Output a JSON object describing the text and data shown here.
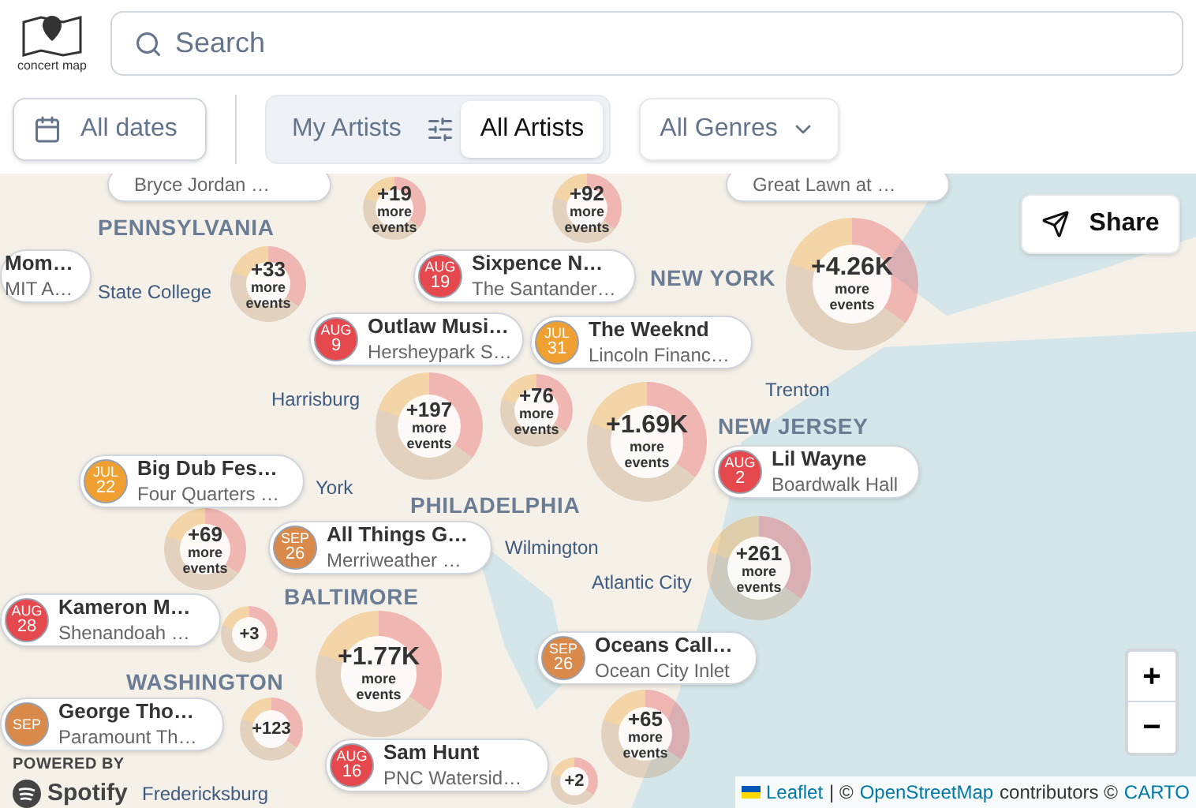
{
  "header": {
    "logo_text": "concert map",
    "search": {
      "placeholder": "Search"
    }
  },
  "filters": {
    "date_button": "All dates",
    "artist_toggle": [
      {
        "label": "My Artists",
        "selected": false
      },
      {
        "label": "All Artists",
        "selected": true
      }
    ],
    "genre_select": "All Genres"
  },
  "map": {
    "share_button": "Share",
    "place_labels": [
      {
        "text": "PENNSYLVANIA",
        "kind": "state"
      },
      {
        "text": "State College",
        "kind": "city"
      },
      {
        "text": "Harrisburg",
        "kind": "city"
      },
      {
        "text": "York",
        "kind": "city"
      },
      {
        "text": "PHILADELPHIA",
        "kind": "state"
      },
      {
        "text": "Wilmington",
        "kind": "city"
      },
      {
        "text": "NEW YORK",
        "kind": "state"
      },
      {
        "text": "NEW JERSEY",
        "kind": "state"
      },
      {
        "text": "Trenton",
        "kind": "city"
      },
      {
        "text": "Atlantic City",
        "kind": "city"
      },
      {
        "text": "BALTIMORE",
        "kind": "state"
      },
      {
        "text": "WASHINGTON",
        "kind": "state"
      },
      {
        "text": "Fredericksburg",
        "kind": "city"
      }
    ],
    "clusters": [
      {
        "count": "+19",
        "label": "more events"
      },
      {
        "count": "+92",
        "label": "more events"
      },
      {
        "count": "+33",
        "label": "more events"
      },
      {
        "count": "+76",
        "label": "more events"
      },
      {
        "count": "+197",
        "label": "more events"
      },
      {
        "count": "+1.69K",
        "label": "more events"
      },
      {
        "count": "+4.26K",
        "label": "more events"
      },
      {
        "count": "+69",
        "label": "more events"
      },
      {
        "count": "+1.77K",
        "label": "more events"
      },
      {
        "count": "+261",
        "label": "more events"
      },
      {
        "count": "+65",
        "label": "more events"
      },
      {
        "count": "+3"
      },
      {
        "count": "+2"
      },
      {
        "count": "+123"
      }
    ],
    "events": [
      {
        "venue": "Bryce Jordan …"
      },
      {
        "venue": "Great Lawn at …"
      },
      {
        "title": "Mom…",
        "venue": "MIT A…"
      },
      {
        "month": "AUG",
        "day": "19",
        "color": "#e5484d",
        "title": "Sixpence N…",
        "venue": "The Santander…"
      },
      {
        "month": "AUG",
        "day": "9",
        "color": "#e5484d",
        "title": "Outlaw Musi…",
        "venue": "Hersheypark S…"
      },
      {
        "month": "JUL",
        "day": "31",
        "color": "#f0a030",
        "title": "The Weeknd",
        "venue": "Lincoln Financ…"
      },
      {
        "month": "JUL",
        "day": "22",
        "color": "#f0a030",
        "title": "Big Dub Fes…",
        "venue": "Four Quarters …"
      },
      {
        "month": "AUG",
        "day": "2",
        "color": "#e5484d",
        "title": "Lil Wayne",
        "venue": "Boardwalk Hall"
      },
      {
        "month": "SEP",
        "day": "26",
        "color": "#d9894a",
        "title": "All Things G…",
        "venue": "Merriweather …"
      },
      {
        "month": "AUG",
        "day": "28",
        "color": "#e5484d",
        "title": "Kameron M…",
        "venue": "Shenandoah …"
      },
      {
        "month": "SEP",
        "day": "26",
        "color": "#d9894a",
        "title": "Oceans Call…",
        "venue": "Ocean City Inlet"
      },
      {
        "month": "AUG",
        "day": "16",
        "color": "#e5484d",
        "title": "Sam Hunt",
        "venue": "PNC Watersid…"
      },
      {
        "month": "SEP",
        "color": "#d9894a",
        "title": "George Tho…",
        "venue": "Paramount Th…"
      }
    ],
    "spotify": {
      "caption": "POWERED BY",
      "brand": "Spotify"
    },
    "zoom": {
      "in": "+",
      "out": "−"
    },
    "attribution": {
      "leaflet": "Leaflet",
      "separator": "| ©",
      "osm": "OpenStreetMap",
      "contributors": "contributors ©",
      "carto": "CARTO"
    }
  }
}
